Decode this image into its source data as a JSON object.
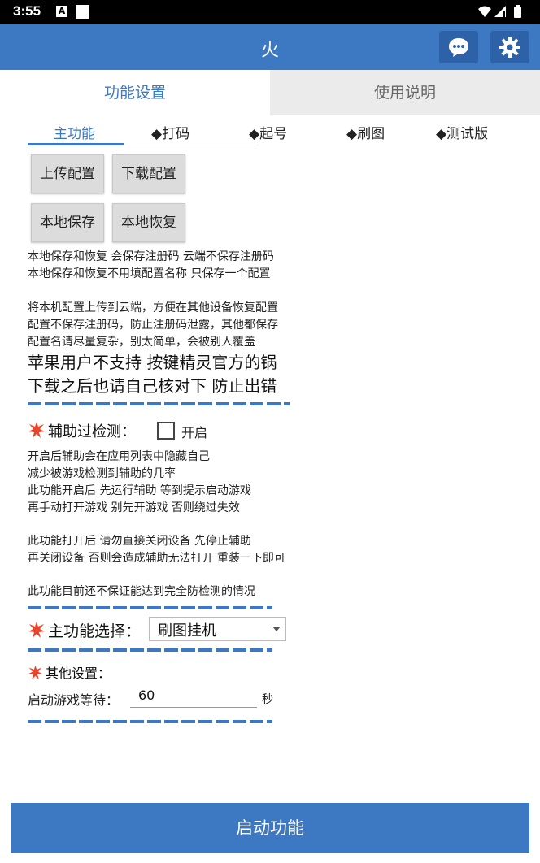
{
  "status_bar": {
    "time": "3:55",
    "notif_icon": "A"
  },
  "app_bar": {
    "title": "火"
  },
  "tabs": {
    "settings": "功能设置",
    "manual": "使用说明"
  },
  "sub_tabs": {
    "main": "主功能",
    "code": "◆打码",
    "start": "◆起号",
    "farm": "◆刷图",
    "test": "◆测试版"
  },
  "buttons": {
    "upload": "上传配置",
    "download": "下载配置",
    "local_save": "本地保存",
    "local_restore": "本地恢复"
  },
  "notes": {
    "line1": "本地保存和恢复 会保存注册码 云端不保存注册码",
    "line2": "本地保存和恢复不用填配置名称 只保存一个配置",
    "line3": "将本机配置上传到云端，方便在其他设备恢复配置",
    "line4": "配置不保存注册码，防止注册码泄露，其他都保存",
    "line5": "配置名请尽量复杂，别太简单，会被别人覆盖",
    "big1": "苹果用户不支持 按键精灵官方的锅",
    "big2": "下载之后也请自己核对下 防止出错"
  },
  "assist": {
    "label": "辅助过检测：",
    "checkbox_label": "开启",
    "checked": false,
    "d1": "开启后辅助会在应用列表中隐藏自己",
    "d2": "减少被游戏检测到辅助的几率",
    "d3": "此功能开启后 先运行辅助 等到提示启动游戏",
    "d4": "再手动打开游戏 别先开游戏 否则绕过失效",
    "d5": "此功能打开后 请勿直接关闭设备 先停止辅助",
    "d6": "再关闭设备 否则会造成辅助无法打开 重装一下即可",
    "d7": "此功能目前还不保证能达到完全防检测的情况"
  },
  "main_select": {
    "label": "主功能选择：",
    "value": "刷图挂机"
  },
  "other": {
    "label": "其他设置：",
    "wait_label": "启动游戏等待：",
    "wait_value": "60",
    "unit": "秒"
  },
  "start_button": "启动功能",
  "colors": {
    "accent": "#3d78c3",
    "appbar_button": "#2e62a8",
    "inactive_tab": "#ebebeb",
    "warning_icon": "#e8442e"
  }
}
